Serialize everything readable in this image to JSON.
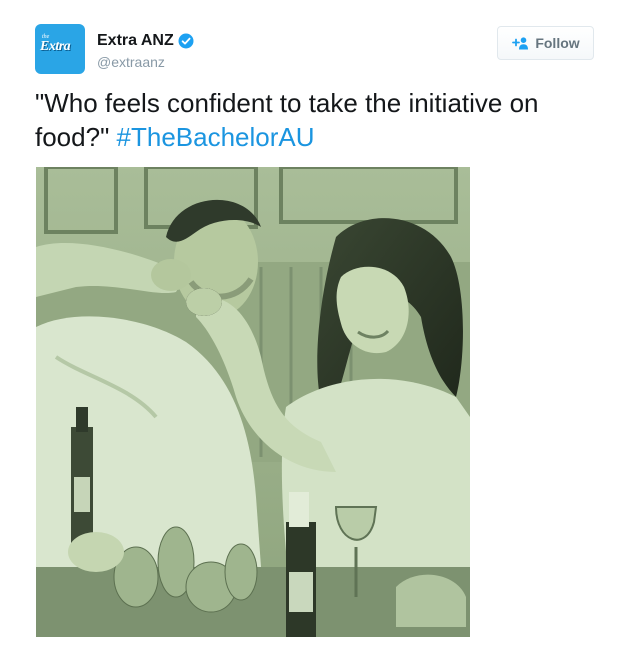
{
  "tweet": {
    "author": {
      "name": "Extra ANZ",
      "handle": "@extraanz",
      "avatar_text_small": "the",
      "avatar_text": "Extra",
      "verified": true
    },
    "follow_label": "Follow",
    "text": "\"Who feels confident to take the initiative on food?\"",
    "hashtag": "#TheBachelorAU",
    "media": {
      "type": "photo",
      "tint": "green"
    }
  },
  "colors": {
    "avatar_bg": "#2aa5e6",
    "verified": "#1da1f2",
    "hashtag": "#1b95e0",
    "handle": "#8899a6",
    "follow_text": "#66757f"
  },
  "icons": {
    "verified": "verified-badge-icon",
    "follow": "add-person-icon"
  }
}
